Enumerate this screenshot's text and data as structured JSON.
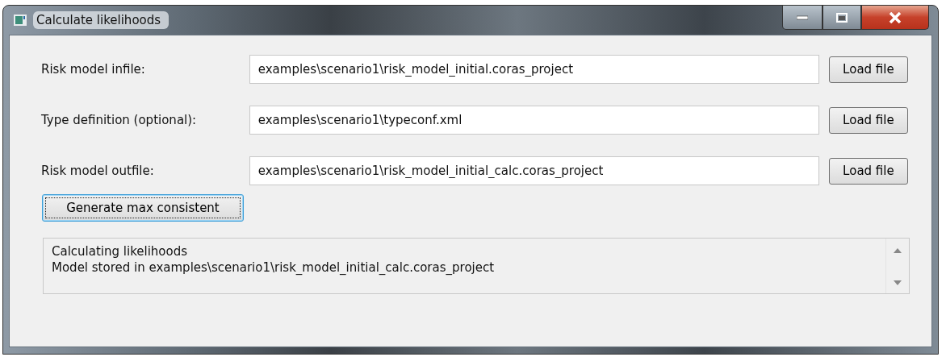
{
  "window": {
    "title": "Calculate likelihoods"
  },
  "fields": [
    {
      "label": "Risk model infile:",
      "value": "examples\\scenario1\\risk_model_initial.coras_project",
      "button": "Load file"
    },
    {
      "label": "Type definition (optional):",
      "value": "examples\\scenario1\\typeconf.xml",
      "button": "Load file"
    },
    {
      "label": "Risk model outfile:",
      "value": "examples\\scenario1\\risk_model_initial_calc.coras_project",
      "button": "Load file"
    }
  ],
  "action_button": {
    "label": "Generate max consistent",
    "focused": true
  },
  "log": {
    "lines": [
      "Calculating likelihoods",
      "Model stored in examples\\scenario1\\risk_model_initial_calc.coras_project"
    ]
  }
}
